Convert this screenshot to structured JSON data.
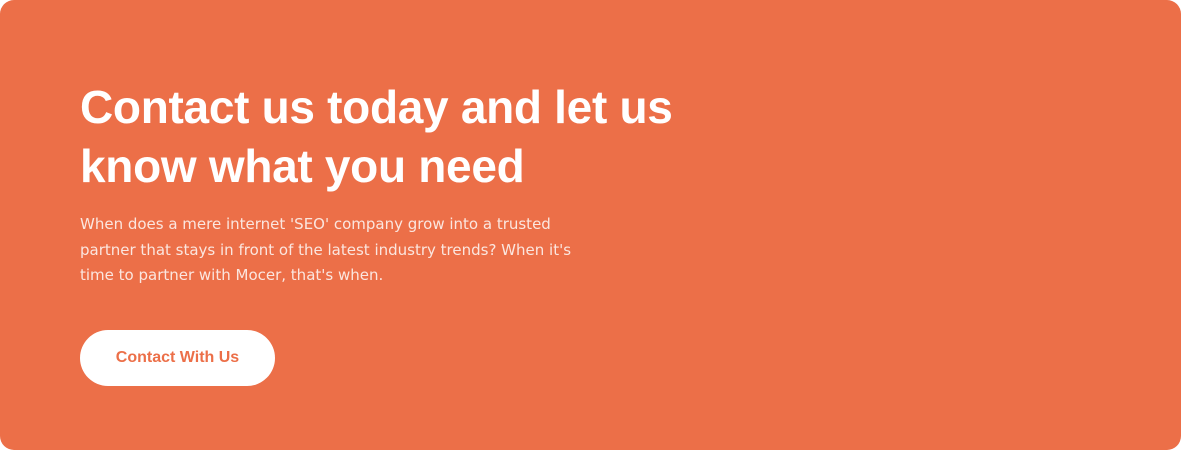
{
  "cta": {
    "title": "Contact us today and let us know what you need",
    "description": "When does a mere internet 'SEO' company grow into a trusted partner that stays in front of the latest industry trends? When it's time to partner with Mocer, that's when.",
    "button_label": "Contact With Us"
  },
  "colors": {
    "background": "#EC6F48",
    "text": "#FFFFFF",
    "button_background": "#FFFFFF",
    "button_text": "#EC6F48"
  }
}
